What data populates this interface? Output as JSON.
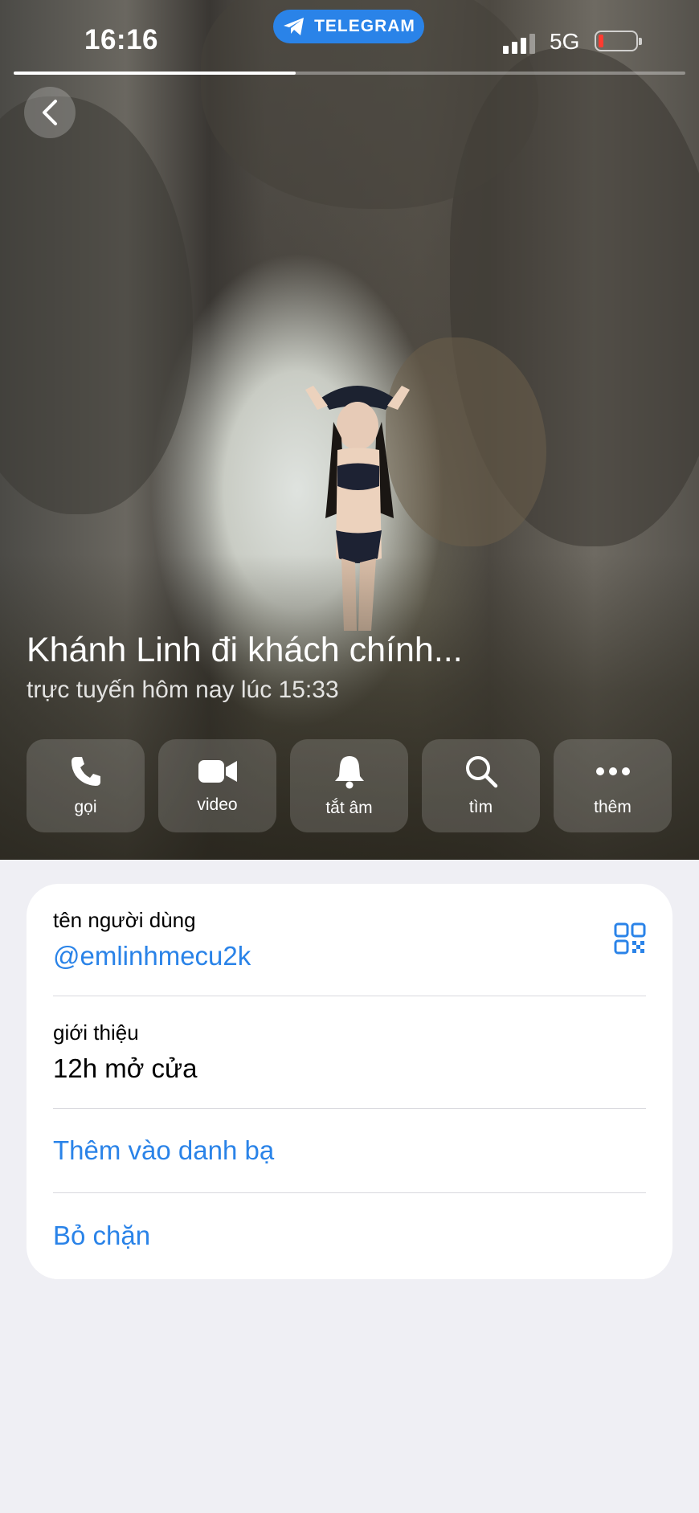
{
  "status_bar": {
    "time": "16:16",
    "app_badge": "TELEGRAM",
    "network": "5G",
    "battery_level_percent": 10,
    "battery_color": "#ff3b30"
  },
  "story_progress": 0.42,
  "profile": {
    "name": "Khánh Linh đi khách chính...",
    "status": "trực tuyến hôm nay lúc 15:33"
  },
  "actions": [
    {
      "label": "gọi",
      "icon": "phone-icon"
    },
    {
      "label": "video",
      "icon": "video-camera-icon"
    },
    {
      "label": "tắt âm",
      "icon": "bell-icon"
    },
    {
      "label": "tìm",
      "icon": "search-icon"
    },
    {
      "label": "thêm",
      "icon": "more-dots-icon"
    }
  ],
  "info": {
    "username_label": "tên người dùng",
    "username": "@emlinhmecu2k",
    "bio_label": "giới thiệu",
    "bio": "12h mở cửa",
    "add_contact": "Thêm vào danh bạ",
    "unblock": "Bỏ chặn"
  },
  "colors": {
    "accent": "#2a83e8",
    "background": "#efeff4",
    "card": "#ffffff"
  }
}
